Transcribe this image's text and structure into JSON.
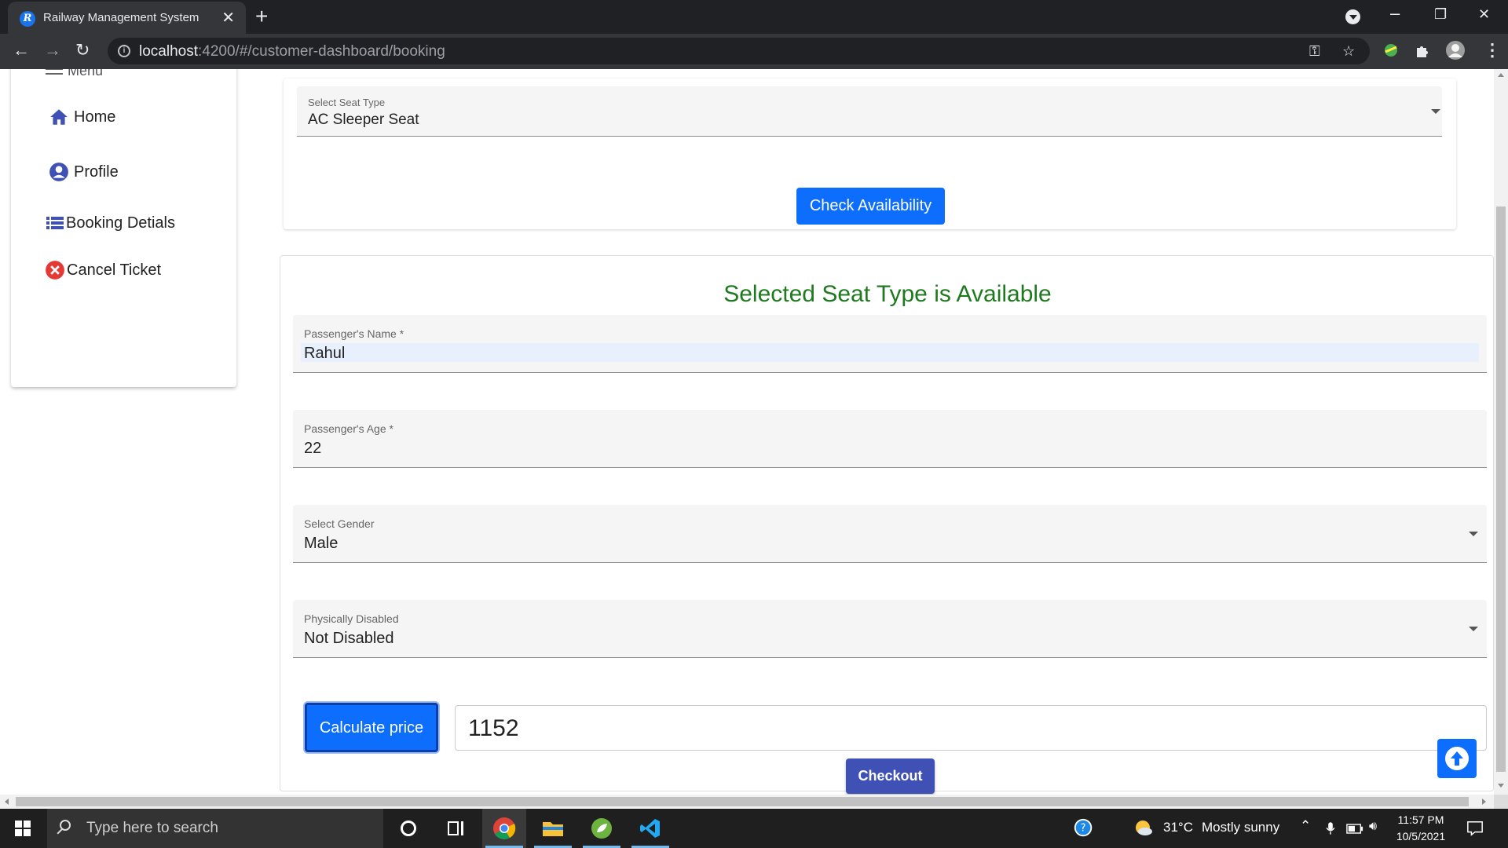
{
  "browser": {
    "tab_title": "Railway Management System",
    "favicon_letter": "R",
    "url_host": "localhost",
    "url_path": ":4200/#/customer-dashboard/booking"
  },
  "sidebar": {
    "menu_label": "Menu",
    "items": [
      {
        "label": "Home",
        "icon": "home-icon"
      },
      {
        "label": "Profile",
        "icon": "account-circle-icon"
      },
      {
        "label": "Booking Detials",
        "icon": "list-icon"
      },
      {
        "label": "Cancel Ticket",
        "icon": "cancel-icon"
      }
    ]
  },
  "seat_section": {
    "seat_type_label": "Select Seat Type",
    "seat_type_value": "AC Sleeper Seat",
    "check_button": "Check Availability"
  },
  "booking_form": {
    "availability_message": "Selected Seat Type is Available",
    "name_label": "Passenger's Name *",
    "name_value": "Rahul",
    "age_label": "Passenger's Age *",
    "age_value": "22",
    "gender_label": "Select Gender",
    "gender_value": "Male",
    "disabled_label": "Physically Disabled",
    "disabled_value": "Not Disabled",
    "calculate_button": "Calculate price",
    "price_value": "1152",
    "checkout_button": "Checkout"
  },
  "taskbar": {
    "search_placeholder": "Type here to search",
    "weather_temp": "31°C",
    "weather_text": "Mostly sunny",
    "time": "11:57 PM",
    "date": "10/5/2021"
  },
  "colors": {
    "primary": "#0d6efd",
    "checkout": "#3f51b5",
    "success": "#1f7a1f",
    "nav_icon": "#3f51b5",
    "cancel_icon": "#e53935"
  }
}
